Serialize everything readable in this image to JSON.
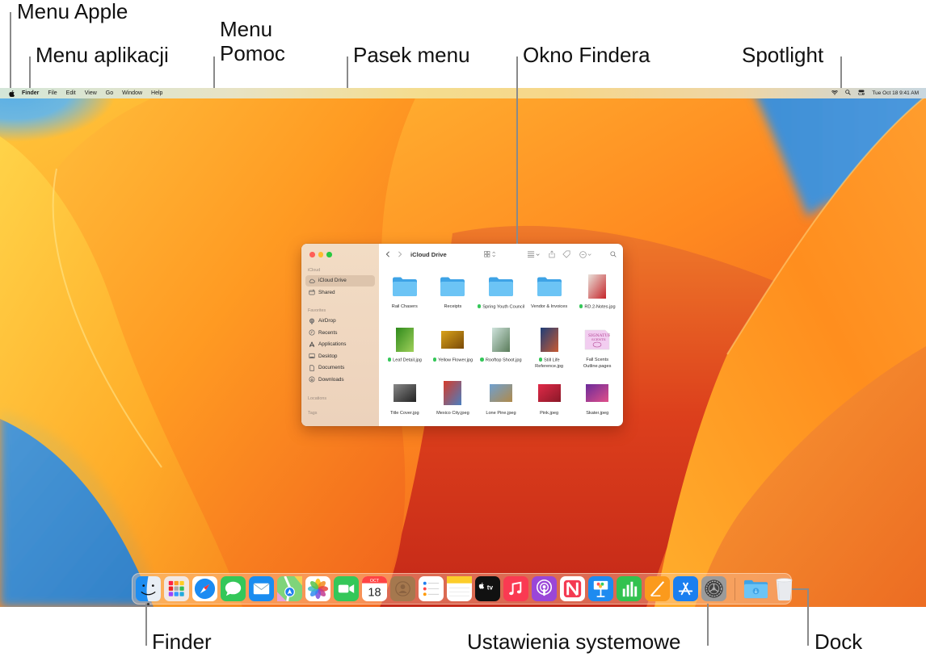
{
  "callouts": {
    "apple_menu": "Menu Apple",
    "app_menu": "Menu aplikacji",
    "help_menu_line1": "Menu",
    "help_menu_line2": "Pomoc",
    "menu_bar": "Pasek menu",
    "finder_window": "Okno Findera",
    "spotlight": "Spotlight",
    "finder": "Finder",
    "system_settings": "Ustawienia systemowe",
    "dock": "Dock"
  },
  "menubar": {
    "apple_icon": "apple-logo-icon",
    "items": [
      "Finder",
      "File",
      "Edit",
      "View",
      "Go",
      "Window",
      "Help"
    ],
    "status": {
      "wifi_icon": "wifi-icon",
      "spotlight_icon": "magnifier-icon",
      "control_center_icon": "control-center-icon",
      "datetime": "Tue Oct 18  9:41 AM"
    }
  },
  "finder_window": {
    "title": "iCloud Drive",
    "traffic_lights": {
      "close": "#ff5f57",
      "minimize": "#febc2e",
      "zoom": "#28c840"
    },
    "sidebar": {
      "sections": [
        {
          "label": "iCloud",
          "items": [
            {
              "label": "iCloud Drive",
              "icon": "cloud-icon",
              "selected": true
            },
            {
              "label": "Shared",
              "icon": "shared-folder-icon",
              "selected": false
            }
          ]
        },
        {
          "label": "Favorites",
          "items": [
            {
              "label": "AirDrop",
              "icon": "airdrop-icon"
            },
            {
              "label": "Recents",
              "icon": "clock-icon"
            },
            {
              "label": "Applications",
              "icon": "applications-icon"
            },
            {
              "label": "Desktop",
              "icon": "desktop-icon"
            },
            {
              "label": "Documents",
              "icon": "document-icon"
            },
            {
              "label": "Downloads",
              "icon": "download-icon"
            }
          ]
        },
        {
          "label": "Locations",
          "items": []
        },
        {
          "label": "Tags",
          "items": []
        }
      ]
    },
    "toolbar": {
      "back": "chevron-left-icon",
      "forward": "chevron-right-icon",
      "view_mode": "grid-view-icon",
      "group": "group-by-icon",
      "share": "share-icon",
      "tag": "tag-icon",
      "more": "ellipsis-circle-icon",
      "search": "search-icon"
    },
    "items": [
      {
        "name": "Rail Chasers",
        "kind": "folder",
        "tag": false
      },
      {
        "name": "Receipts",
        "kind": "folder",
        "tag": false
      },
      {
        "name": "Spring Youth Council",
        "kind": "folder",
        "tag": true
      },
      {
        "name": "Vendor & Invoices",
        "kind": "folder",
        "tag": false
      },
      {
        "name": "RD.2-Notes.jpg",
        "kind": "image",
        "tag": true,
        "colors": [
          "#e9e1da",
          "#c5252a"
        ]
      },
      {
        "name": "Leaf Detail.jpg",
        "kind": "image",
        "tag": true,
        "colors": [
          "#2f8a1c",
          "#9fd05a"
        ]
      },
      {
        "name": "Yellow Flower.jpg",
        "kind": "image",
        "tag": true,
        "colors": [
          "#d9a21a",
          "#7a4a08"
        ]
      },
      {
        "name": "Rooftop Shoot.jpg",
        "kind": "image",
        "tag": true,
        "colors": [
          "#cfe3dc",
          "#5a7c5a"
        ]
      },
      {
        "name": "Still Life Reference.jpg",
        "kind": "image",
        "tag": true,
        "colors": [
          "#1f3e78",
          "#c85a32"
        ]
      },
      {
        "name": "Fall Scents Outline.pages",
        "kind": "doc",
        "tag": false,
        "colors": [
          "#f2cdf0",
          "#b04090"
        ]
      },
      {
        "name": "Title Cover.jpg",
        "kind": "image",
        "tag": false,
        "colors": [
          "#888888",
          "#222222"
        ]
      },
      {
        "name": "Mexico City.jpeg",
        "kind": "image",
        "tag": false,
        "colors": [
          "#d63b2a",
          "#4a7fc0"
        ]
      },
      {
        "name": "Lone Pine.jpeg",
        "kind": "image",
        "tag": false,
        "colors": [
          "#6fa0d0",
          "#b08a4a"
        ]
      },
      {
        "name": "Pink.jpeg",
        "kind": "image",
        "tag": false,
        "colors": [
          "#e02a48",
          "#8a1828"
        ]
      },
      {
        "name": "Skater.jpeg",
        "kind": "image",
        "tag": false,
        "colors": [
          "#6a2a9a",
          "#e0508a"
        ]
      }
    ]
  },
  "dock": {
    "apps": [
      {
        "name": "Finder",
        "icon": "finder-icon",
        "running": true
      },
      {
        "name": "Launchpad",
        "icon": "launchpad-icon"
      },
      {
        "name": "Safari",
        "icon": "safari-icon"
      },
      {
        "name": "Messages",
        "icon": "messages-icon"
      },
      {
        "name": "Mail",
        "icon": "mail-icon"
      },
      {
        "name": "Maps",
        "icon": "maps-icon"
      },
      {
        "name": "Photos",
        "icon": "photos-icon"
      },
      {
        "name": "FaceTime",
        "icon": "facetime-icon"
      },
      {
        "name": "Calendar",
        "icon": "calendar-icon",
        "month": "OCT",
        "day": "18"
      },
      {
        "name": "Contacts",
        "icon": "contacts-icon"
      },
      {
        "name": "Reminders",
        "icon": "reminders-icon"
      },
      {
        "name": "Notes",
        "icon": "notes-icon"
      },
      {
        "name": "TV",
        "icon": "apple-tv-icon",
        "text": "tv"
      },
      {
        "name": "Music",
        "icon": "music-icon"
      },
      {
        "name": "Podcasts",
        "icon": "podcasts-icon"
      },
      {
        "name": "News",
        "icon": "news-icon"
      },
      {
        "name": "Keynote",
        "icon": "keynote-icon"
      },
      {
        "name": "Numbers",
        "icon": "numbers-icon"
      },
      {
        "name": "Pages",
        "icon": "pages-icon"
      },
      {
        "name": "App Store",
        "icon": "app-store-icon"
      },
      {
        "name": "System Settings",
        "icon": "system-settings-icon"
      }
    ],
    "extras": [
      {
        "name": "Downloads",
        "icon": "downloads-folder-icon"
      },
      {
        "name": "Trash",
        "icon": "trash-icon"
      }
    ]
  }
}
